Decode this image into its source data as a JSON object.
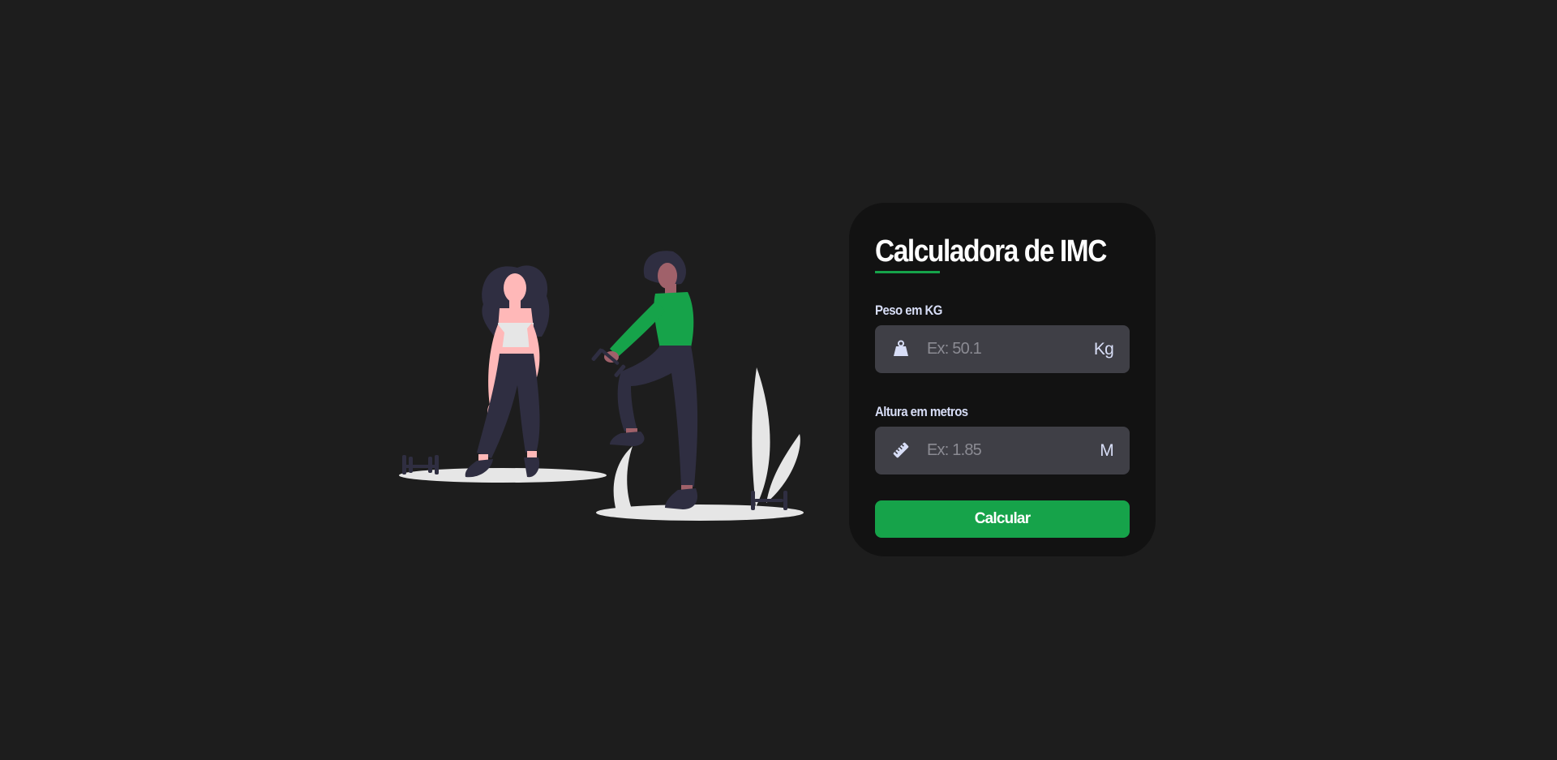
{
  "card": {
    "title": "Calculadora de IMC"
  },
  "weight": {
    "label": "Peso em KG",
    "placeholder": "Ex: 50.1",
    "value": "",
    "unit": "Kg",
    "icon": "weight-icon"
  },
  "height": {
    "label": "Altura em metros",
    "placeholder": "Ex: 1.85",
    "value": "",
    "unit": "M",
    "icon": "ruler-icon"
  },
  "button": {
    "label": "Calcular"
  },
  "illustration": {
    "subject": "two-women-exercising-with-dumbbells"
  },
  "colors": {
    "background": "#1d1d1d",
    "card": "#121212",
    "accent": "#16a34a",
    "input": "#3f3f46",
    "label": "#d8def7"
  }
}
